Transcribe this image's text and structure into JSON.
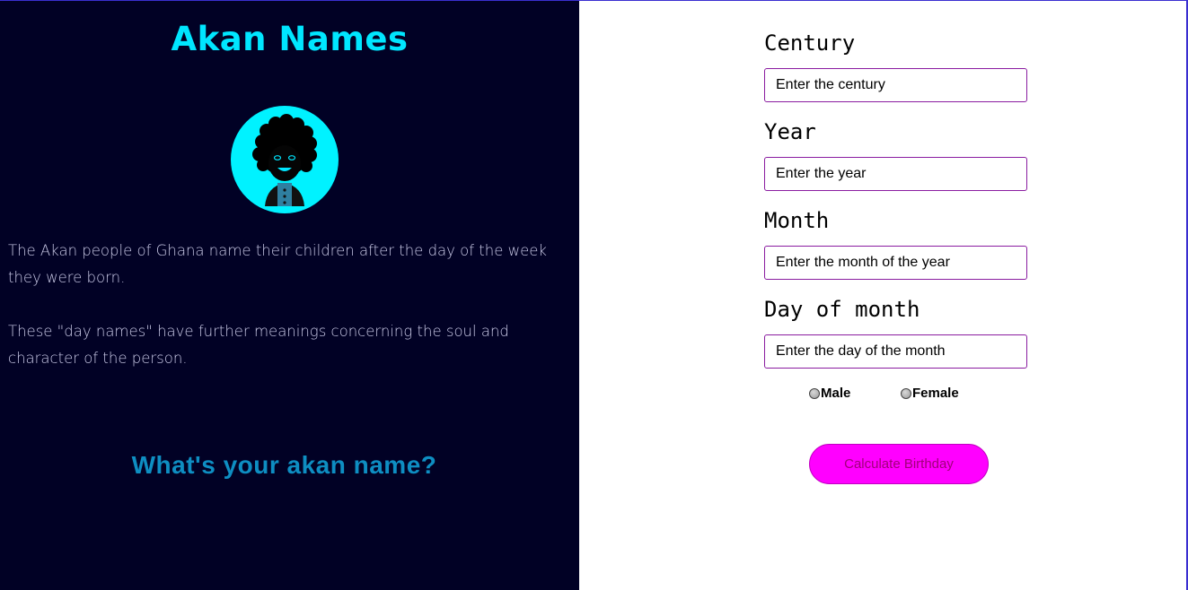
{
  "hero": {
    "title": "Akan Names",
    "intro": [
      "The Akan people of Ghana name their children after the day of the week they were born.",
      "These \"day names\" have further meanings concerning the soul and character of the person."
    ],
    "cta": "What's your akan name?"
  },
  "form": {
    "century": {
      "label": "Century",
      "placeholder": "Enter the century"
    },
    "year": {
      "label": "Year",
      "placeholder": "Enter the year"
    },
    "month": {
      "label": "Month",
      "placeholder": "Enter the month of the year"
    },
    "day": {
      "label": "Day of month",
      "placeholder": "Enter the day of the month"
    },
    "gender": [
      {
        "label": "Male"
      },
      {
        "label": "Female"
      }
    ],
    "submit_label": "Calculate Birthday"
  },
  "colors": {
    "panel_bg": "#010125",
    "accent_cyan": "#00e6ff",
    "cta_blue": "#0e8ec2",
    "button_magenta": "#ff00ff",
    "input_border": "#8a1ca0"
  },
  "icons": {
    "avatar": "afro-person-avatar-icon"
  }
}
